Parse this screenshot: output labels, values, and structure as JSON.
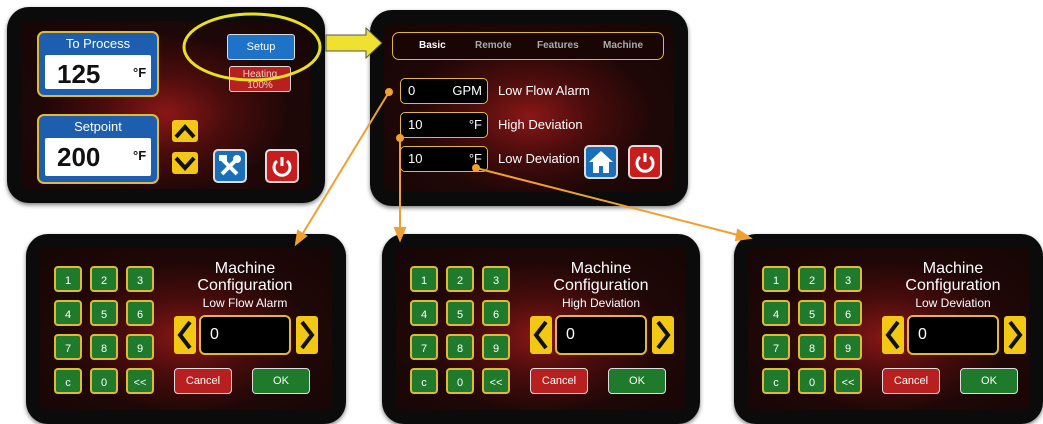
{
  "main_screen": {
    "to_process": {
      "caption": "To Process",
      "value": "125",
      "unit": "°F"
    },
    "setpoint": {
      "caption": "Setpoint",
      "value": "200",
      "unit": "°F"
    },
    "setup_label": "Setup",
    "heating_label": "Heating",
    "heating_percent": "100%"
  },
  "setup_screen": {
    "tabs": [
      "Basic",
      "Remote",
      "Features",
      "Machine"
    ],
    "fields": [
      {
        "value": "0",
        "unit": "GPM",
        "label": "Low Flow Alarm"
      },
      {
        "value": "10",
        "unit": "°F",
        "label": "High Deviation"
      },
      {
        "value": "10",
        "unit": "°F",
        "label": "Low Deviation"
      }
    ]
  },
  "keypad_screens": [
    {
      "title": "Machine Configuration",
      "subtitle": "Low Flow Alarm",
      "entry": "0"
    },
    {
      "title": "Machine Configuration",
      "subtitle": "High Deviation",
      "entry": "0"
    },
    {
      "title": "Machine Configuration",
      "subtitle": "Low Deviation",
      "entry": "0"
    }
  ],
  "keypad": {
    "keys": [
      "1",
      "2",
      "3",
      "4",
      "5",
      "6",
      "7",
      "8",
      "9",
      "c",
      "0",
      "<<"
    ],
    "cancel_label": "Cancel",
    "ok_label": "OK"
  },
  "colors": {
    "callout": "#f0a030",
    "highlight": "#e8e020",
    "frame": "#0b0b0b"
  }
}
